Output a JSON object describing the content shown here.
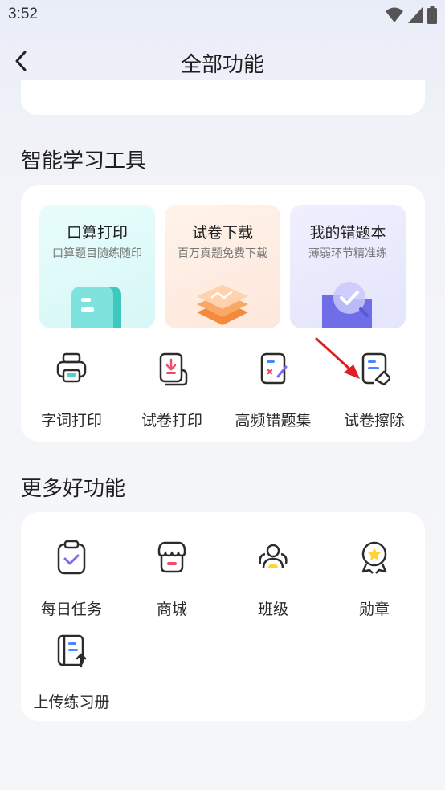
{
  "status_bar": {
    "time": "3:52"
  },
  "header": {
    "title": "全部功能"
  },
  "study_tools": {
    "title": "智能学习工具",
    "tiles": [
      {
        "title": "口算打印",
        "subtitle": "口算题目随练随印"
      },
      {
        "title": "试卷下载",
        "subtitle": "百万真题免费下载"
      },
      {
        "title": "我的错题本",
        "subtitle": "薄弱环节精准练"
      }
    ],
    "items": [
      {
        "label": "字词打印",
        "icon": "printer-icon"
      },
      {
        "label": "试卷打印",
        "icon": "paper-print-icon"
      },
      {
        "label": "高频错题集",
        "icon": "mistake-collection-icon"
      },
      {
        "label": "试卷擦除",
        "icon": "paper-erase-icon"
      }
    ]
  },
  "more_features": {
    "title": "更多好功能",
    "items": [
      {
        "label": "每日任务",
        "icon": "clipboard-check-icon"
      },
      {
        "label": "商城",
        "icon": "shop-icon"
      },
      {
        "label": "班级",
        "icon": "class-group-icon"
      },
      {
        "label": "勋章",
        "icon": "medal-icon"
      },
      {
        "label": "上传练习册",
        "icon": "upload-workbook-icon"
      }
    ]
  },
  "colors": {
    "tile_cyan": "#dffbfa",
    "tile_orange": "#fdeee4",
    "tile_purple": "#eaeaff",
    "accent_pink": "#f04b6a",
    "accent_blue": "#4a86ff",
    "accent_purple": "#7b6cf6",
    "accent_yellow": "#ffd23a",
    "annotation_red": "#e02020"
  }
}
